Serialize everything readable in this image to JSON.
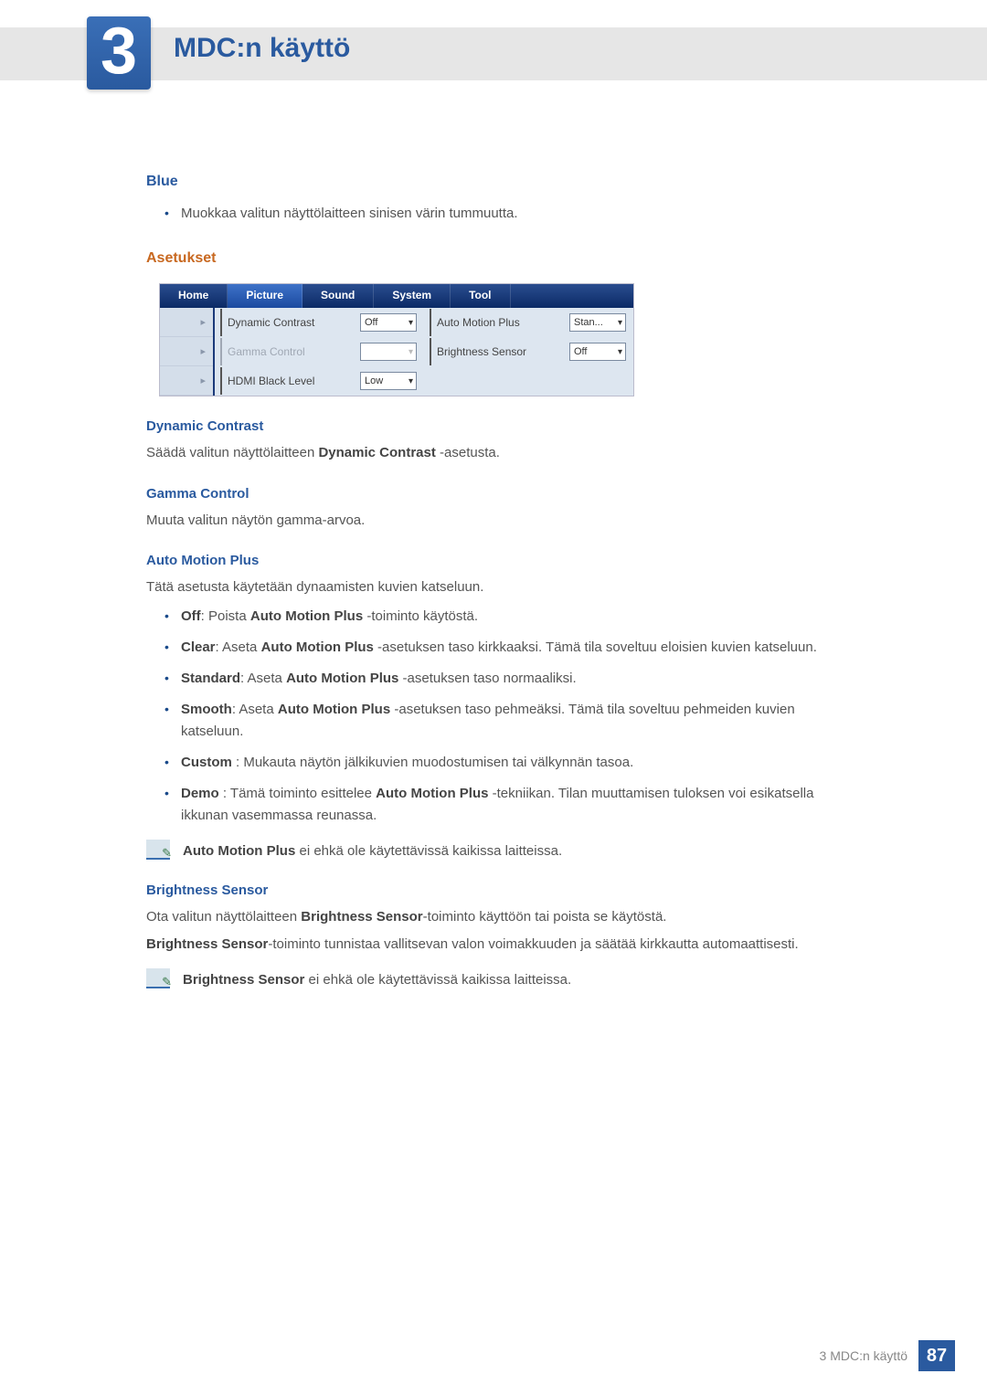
{
  "header": {
    "chapter_number": "3",
    "chapter_title": "MDC:n käyttö"
  },
  "section_blue": {
    "title": "Blue",
    "bullet": "Muokkaa valitun näyttölaitteen sinisen värin tummuutta."
  },
  "section_settings_title": "Asetukset",
  "ui_panel": {
    "tabs": [
      "Home",
      "Picture",
      "Sound",
      "System",
      "Tool"
    ],
    "active_tab_index": 1,
    "sidebar_arrows": [
      "▸",
      "▸",
      "▸"
    ],
    "rows": [
      {
        "label_l": "Dynamic Contrast",
        "select_l": "Off",
        "label_r": "Auto Motion Plus",
        "select_r": "Stan...",
        "disabled": false
      },
      {
        "label_l": "Gamma Control",
        "select_l": "",
        "label_r": "Brightness Sensor",
        "select_r": "Off",
        "disabled": true
      },
      {
        "label_l": "HDMI Black Level",
        "select_l": "Low",
        "label_r": "",
        "select_r": "",
        "disabled": false
      }
    ]
  },
  "dyn_contrast": {
    "title": "Dynamic Contrast",
    "text_pre": "Säädä valitun näyttölaitteen ",
    "text_bold": "Dynamic Contrast",
    "text_post": " -asetusta."
  },
  "gamma": {
    "title": "Gamma Control",
    "text": "Muuta valitun näytön gamma-arvoa."
  },
  "amp": {
    "title": "Auto Motion Plus",
    "intro": "Tätä asetusta käytetään dynaamisten kuvien katseluun.",
    "items": {
      "off_b": "Off",
      "off_t": ": Poista ",
      "off_b2": "Auto Motion Plus",
      "off_t2": " -toiminto käytöstä.",
      "clear_b": "Clear",
      "clear_t": ": Aseta ",
      "clear_b2": "Auto Motion Plus",
      "clear_t2": " -asetuksen taso kirkkaaksi. Tämä tila soveltuu eloisien kuvien katseluun.",
      "std_b": "Standard",
      "std_t": ": Aseta ",
      "std_b2": "Auto Motion Plus",
      "std_t2": " -asetuksen taso normaaliksi.",
      "smooth_b": "Smooth",
      "smooth_t": ": Aseta ",
      "smooth_b2": "Auto Motion Plus",
      "smooth_t2": " -asetuksen taso pehmeäksi. Tämä tila soveltuu pehmeiden kuvien katseluun.",
      "custom_b": "Custom",
      "custom_t": " : Mukauta näytön jälkikuvien muodostumisen tai välkynnän tasoa.",
      "demo_b": "Demo",
      "demo_t": " : Tämä toiminto esittelee ",
      "demo_b2": "Auto Motion Plus",
      "demo_t2": " -tekniikan. Tilan muuttamisen tuloksen voi esikatsella ikkunan vasemmassa reunassa."
    },
    "note_b": "Auto Motion Plus",
    "note_t": " ei ehkä ole käytettävissä kaikissa laitteissa."
  },
  "brightness": {
    "title": "Brightness Sensor",
    "p1_pre": "Ota valitun näyttölaitteen ",
    "p1_b": "Brightness Sensor",
    "p1_post": "-toiminto käyttöön tai poista se käytöstä.",
    "p2_b": "Brightness Sensor",
    "p2_post": "-toiminto tunnistaa vallitsevan valon voimakkuuden ja säätää kirkkautta automaattisesti.",
    "note_b": "Brightness Sensor",
    "note_t": " ei ehkä ole käytettävissä kaikissa laitteissa."
  },
  "footer": {
    "text": "3 MDC:n käyttö",
    "page": "87"
  }
}
